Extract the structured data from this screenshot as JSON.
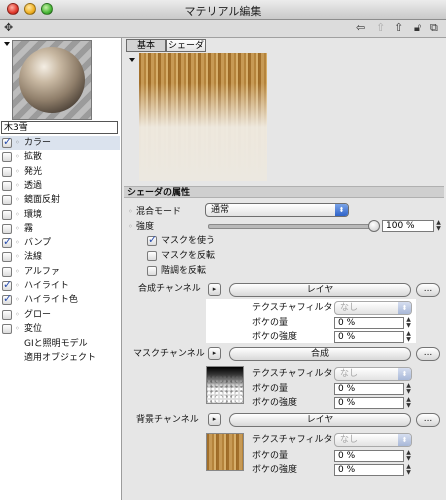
{
  "window": {
    "title": "マテリアル編集"
  },
  "toolbar": {
    "left_icon": "pin-icon",
    "right_icons": [
      "back-arrow-icon",
      "forward-arrow-icon",
      "up-arrow-icon",
      "lock-icon",
      "new-window-icon"
    ]
  },
  "material": {
    "name": "木3雪"
  },
  "channels": [
    {
      "label": "カラー",
      "checked": true,
      "selected": true
    },
    {
      "label": "拡散",
      "checked": false
    },
    {
      "label": "発光",
      "checked": false
    },
    {
      "label": "透過",
      "checked": false
    },
    {
      "label": "鏡面反射",
      "checked": false
    },
    {
      "label": "環境",
      "checked": false
    },
    {
      "label": "霧",
      "checked": false
    },
    {
      "label": "バンプ",
      "checked": true
    },
    {
      "label": "法線",
      "checked": false
    },
    {
      "label": "アルファ",
      "checked": false
    },
    {
      "label": "ハイライト",
      "checked": true
    },
    {
      "label": "ハイライト色",
      "checked": true
    },
    {
      "label": "グロー",
      "checked": false
    },
    {
      "label": "変位",
      "checked": false
    }
  ],
  "extras": [
    "GIと照明モデル",
    "適用オブジェクト"
  ],
  "tabs": [
    {
      "label": "基本",
      "active": true
    },
    {
      "label": "シェーダ",
      "active": false
    }
  ],
  "shader": {
    "section_title": "シェーダの属性",
    "blend_mode_label": "混合モード",
    "blend_mode_value": "通常",
    "strength_label": "強度",
    "strength_value": "100 %",
    "strength_fraction": 1.0,
    "use_mask_label": "マスクを使う",
    "use_mask_checked": true,
    "invert_mask_label": "マスクを反転",
    "invert_mask_checked": false,
    "invert_tone_label": "階調を反転",
    "invert_tone_checked": false
  },
  "composite": {
    "label": "合成チャンネル",
    "button": "レイヤ",
    "filter_label": "テクスチャフィルタ",
    "filter_value": "なし",
    "blur_amount_label": "ボケの量",
    "blur_amount_value": "0 %",
    "blur_strength_label": "ボケの強度",
    "blur_strength_value": "0 %"
  },
  "mask": {
    "label": "マスクチャンネル",
    "button": "合成",
    "filter_label": "テクスチャフィルタ",
    "filter_value": "なし",
    "blur_amount_label": "ボケの量",
    "blur_amount_value": "0 %",
    "blur_strength_label": "ボケの強度",
    "blur_strength_value": "0 %"
  },
  "background": {
    "label": "背景チャンネル",
    "button": "レイヤ",
    "filter_label": "テクスチャフィルタ",
    "filter_value": "なし",
    "blur_amount_label": "ボケの量",
    "blur_amount_value": "0 %",
    "blur_strength_label": "ボケの強度",
    "blur_strength_value": "0 %"
  },
  "more_button": "...",
  "colors": {
    "accent": "#2f63c8",
    "selection": "#dbe3ee"
  }
}
